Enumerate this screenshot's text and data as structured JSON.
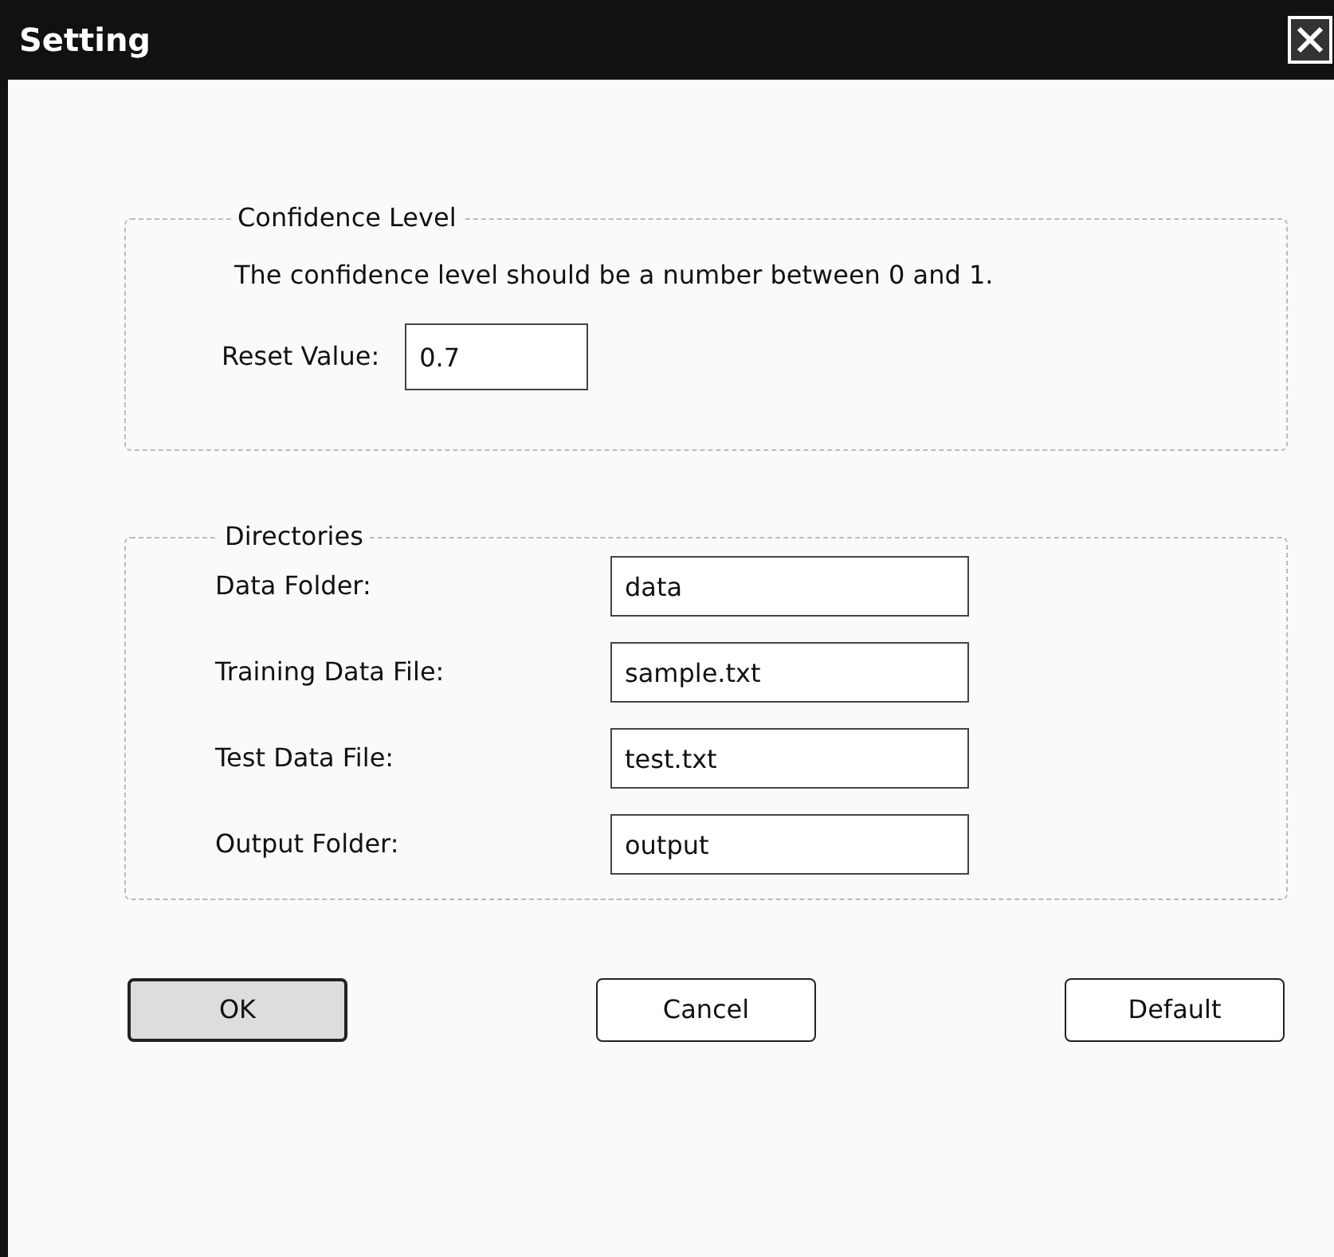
{
  "window": {
    "title": "Setting"
  },
  "confidence": {
    "title": "Confidence Level",
    "note": "The confidence level should be a number between 0 and 1.",
    "label": "Reset Value:",
    "value": "0.7"
  },
  "directories": {
    "title": "Directories",
    "fields": [
      {
        "label": "Data Folder:",
        "value": "data"
      },
      {
        "label": "Training Data File:",
        "value": "sample.txt"
      },
      {
        "label": "Test Data File:",
        "value": "test.txt"
      },
      {
        "label": "Output Folder:",
        "value": "output"
      }
    ]
  },
  "buttons": [
    {
      "label": "OK",
      "default": true
    },
    {
      "label": "Cancel",
      "default": false
    },
    {
      "label": "Default",
      "default": false
    }
  ]
}
